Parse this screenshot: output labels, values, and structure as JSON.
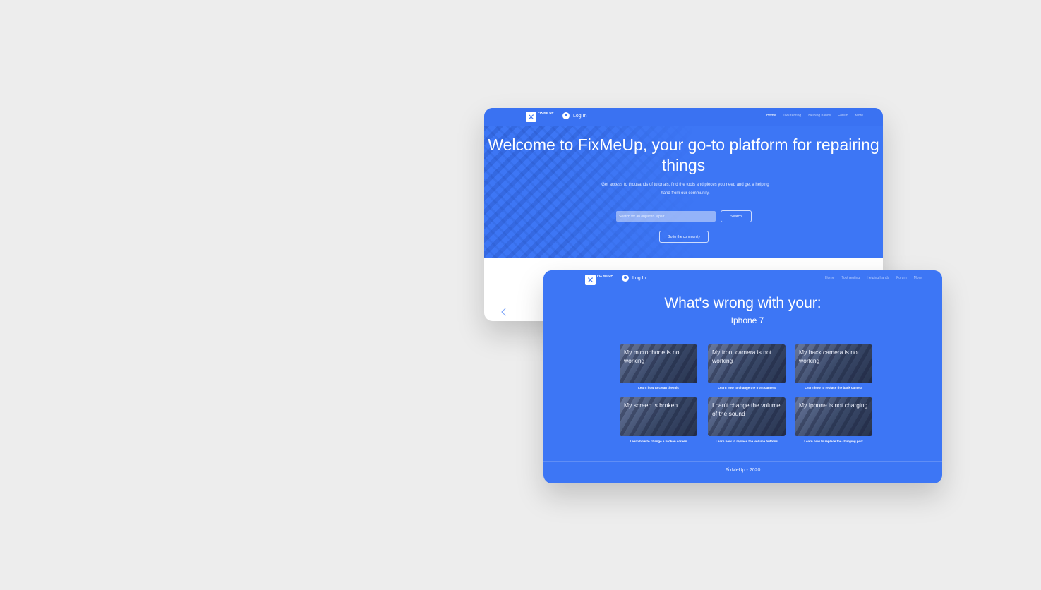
{
  "brand": {
    "logo_text": "FIX ME UP",
    "login_label": "Log In"
  },
  "home_page": {
    "nav": [
      "Home",
      "Tool renting",
      "Helping hands",
      "Forum",
      "More"
    ],
    "title": "Welcome to FixMeUp, your go-to platform for repairing things",
    "subtitle": "Get access to thousands of tutorials, find the tools and pieces you need and get a helping hand from our community.",
    "search_placeholder": "Search for an object to repair",
    "search_button": "Search",
    "community_button": "Go to the community"
  },
  "issues_page": {
    "nav": [
      "Home",
      "Tool renting",
      "Helping hands",
      "Forum",
      "More"
    ],
    "title": "What's wrong with your:",
    "device": "Iphone 7",
    "tiles": [
      {
        "title": "My microphone is not working",
        "caption": "Learn how to clean the mic"
      },
      {
        "title": "My front camera is not working",
        "caption": "Learn how to change the front camera"
      },
      {
        "title": "My back camera is not working",
        "caption": "Learn how to replace the back camera"
      },
      {
        "title": "My screen is broken",
        "caption": "Learn how to change a broken screen"
      },
      {
        "title": "I can't change the volume of the sound",
        "caption": "Learn how to replace the volume buttons"
      },
      {
        "title": "My Iphone is not charging",
        "caption": "Learn how to replace the charging port"
      }
    ],
    "footer": "FixMeUp - 2020"
  },
  "colors": {
    "brand_blue": "#3d76f5",
    "background": "#ededed"
  },
  "icons": [
    "logo-icon",
    "user-icon",
    "chevron-left-icon"
  ]
}
